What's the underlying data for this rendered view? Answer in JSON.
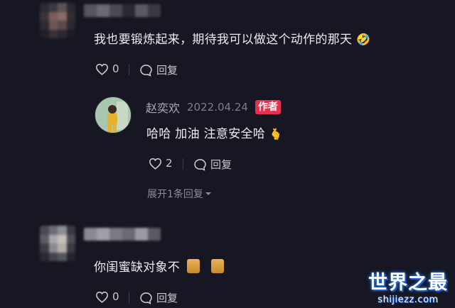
{
  "comment1": {
    "text": "我也要锻炼起来，期待我可以做这个动作的那天",
    "emoji": "🤣",
    "like_count": "0",
    "reply_label": "回复"
  },
  "reply1": {
    "author": "赵奕欢",
    "date": "2022.04.24",
    "badge": "作者",
    "text": "哈哈 加油 注意安全哈",
    "emoji": "🫰",
    "like_count": "2",
    "reply_label": "回复",
    "expand_label": "展开1条回复"
  },
  "comment2": {
    "text": "你闺蜜缺对象不",
    "like_count": "0",
    "reply_label": "回复"
  },
  "watermark": {
    "title": "世界之最",
    "url": "shijiezz.com"
  },
  "colors": {
    "background": "#161722",
    "badge": "#e8304c",
    "text": "#ececf0",
    "muted": "#7d7e89"
  }
}
